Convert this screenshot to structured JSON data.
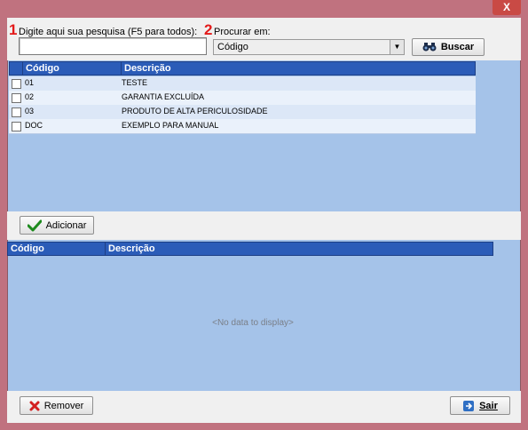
{
  "window": {
    "close_glyph": "X"
  },
  "search": {
    "marker1": "1",
    "prompt_label": "Digite aqui sua pesquisa (F5 para todos):",
    "marker2": "2",
    "field_label": "Procurar em:",
    "value": "",
    "field_selected": "Código",
    "search_button": "Buscar"
  },
  "top_grid": {
    "columns": [
      "Código",
      "Descrição"
    ],
    "rows": [
      {
        "code": "01",
        "description": "TESTE"
      },
      {
        "code": "02",
        "description": "GARANTIA EXCLUÍDA"
      },
      {
        "code": "03",
        "description": "PRODUTO DE ALTA PERICULOSIDADE"
      },
      {
        "code": "DOC",
        "description": "EXEMPLO PARA MANUAL"
      }
    ]
  },
  "actions": {
    "add_button": "Adicionar"
  },
  "bottom_grid": {
    "columns": [
      "Código",
      "Descrição"
    ],
    "empty_text": "<No data to display>"
  },
  "footer": {
    "remove_button": "Remover",
    "exit_button": "Sair"
  },
  "colors": {
    "header": "#2b5cb8",
    "panel": "#a5c3e9",
    "marker": "#e31a1a"
  }
}
